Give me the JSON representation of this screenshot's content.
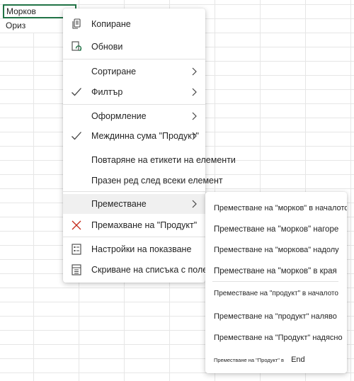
{
  "sheet": {
    "cells": [
      "Морков",
      "Ориз"
    ]
  },
  "menu": {
    "copy": "Копиране",
    "refresh": "Обнови",
    "sort": "Сортиране",
    "filter": "Филтър",
    "format": "Оформление",
    "subtotal": "Междинна сума \"Продукт\"",
    "repeat_labels": "Повтаряне на етикети на елементи",
    "blank_row": "Празен ред след всеки елемент",
    "move": "Преместване",
    "remove": "Премахване на \"Продукт\"",
    "display_settings": "Настройки на показване",
    "hide_field_list": "Скриване на списъка с полета"
  },
  "submenu": {
    "items": [
      "Преместване на \"морков\" в началото",
      "Преместване на \"морков\" нагоре",
      "Преместване на \"моркова\" надолу",
      "Преместване на \"морков\" в края",
      "Преместване на \"продукт\" в началото",
      "Преместване на \"продукт\" наляво",
      "Преместване на \"Продукт\" надясно",
      "Преместване на \"Продукт\" в",
      "End"
    ]
  },
  "colors": {
    "accent_green": "#217346",
    "remove_red": "#c42b1c",
    "hover_bg": "#f0f0f0"
  }
}
